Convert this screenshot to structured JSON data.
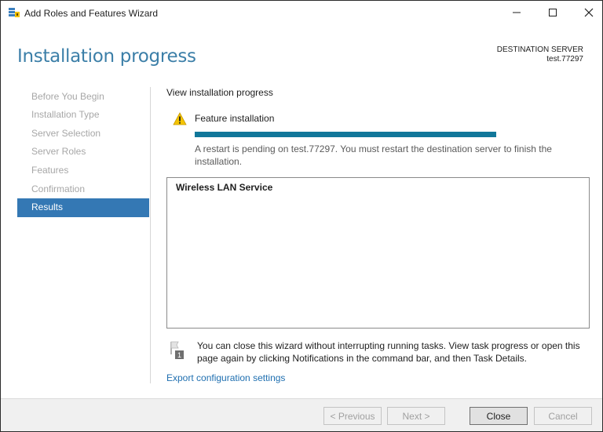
{
  "window": {
    "title": "Add Roles and Features Wizard",
    "icon": "server-manager-icon"
  },
  "header": {
    "page_title": "Installation progress",
    "destination_label": "DESTINATION SERVER",
    "destination_value": "test.77297"
  },
  "nav": {
    "items": [
      {
        "label": "Before You Begin",
        "active": false
      },
      {
        "label": "Installation Type",
        "active": false
      },
      {
        "label": "Server Selection",
        "active": false
      },
      {
        "label": "Server Roles",
        "active": false
      },
      {
        "label": "Features",
        "active": false
      },
      {
        "label": "Confirmation",
        "active": false
      },
      {
        "label": "Results",
        "active": true
      }
    ]
  },
  "main": {
    "section_title": "View installation progress",
    "status_icon": "warning-icon",
    "feature_label": "Feature installation",
    "progress": 1.0,
    "progress_color": "#11779a",
    "restart_message": "A restart is pending on test.77297. You must restart the destination server to finish the installation.",
    "results": [
      "Wireless LAN Service"
    ],
    "note_icon": "notification-flag-icon",
    "note_text": "You can close this wizard without interrupting running tasks. View task progress or open this page again by clicking Notifications in the command bar, and then Task Details.",
    "export_link": "Export configuration settings"
  },
  "footer": {
    "previous_label": "< Previous",
    "next_label": "Next >",
    "close_label": "Close",
    "cancel_label": "Cancel"
  },
  "colors": {
    "accent": "#3478b4",
    "title": "#3c7fa8",
    "link": "#1f6fb0"
  }
}
